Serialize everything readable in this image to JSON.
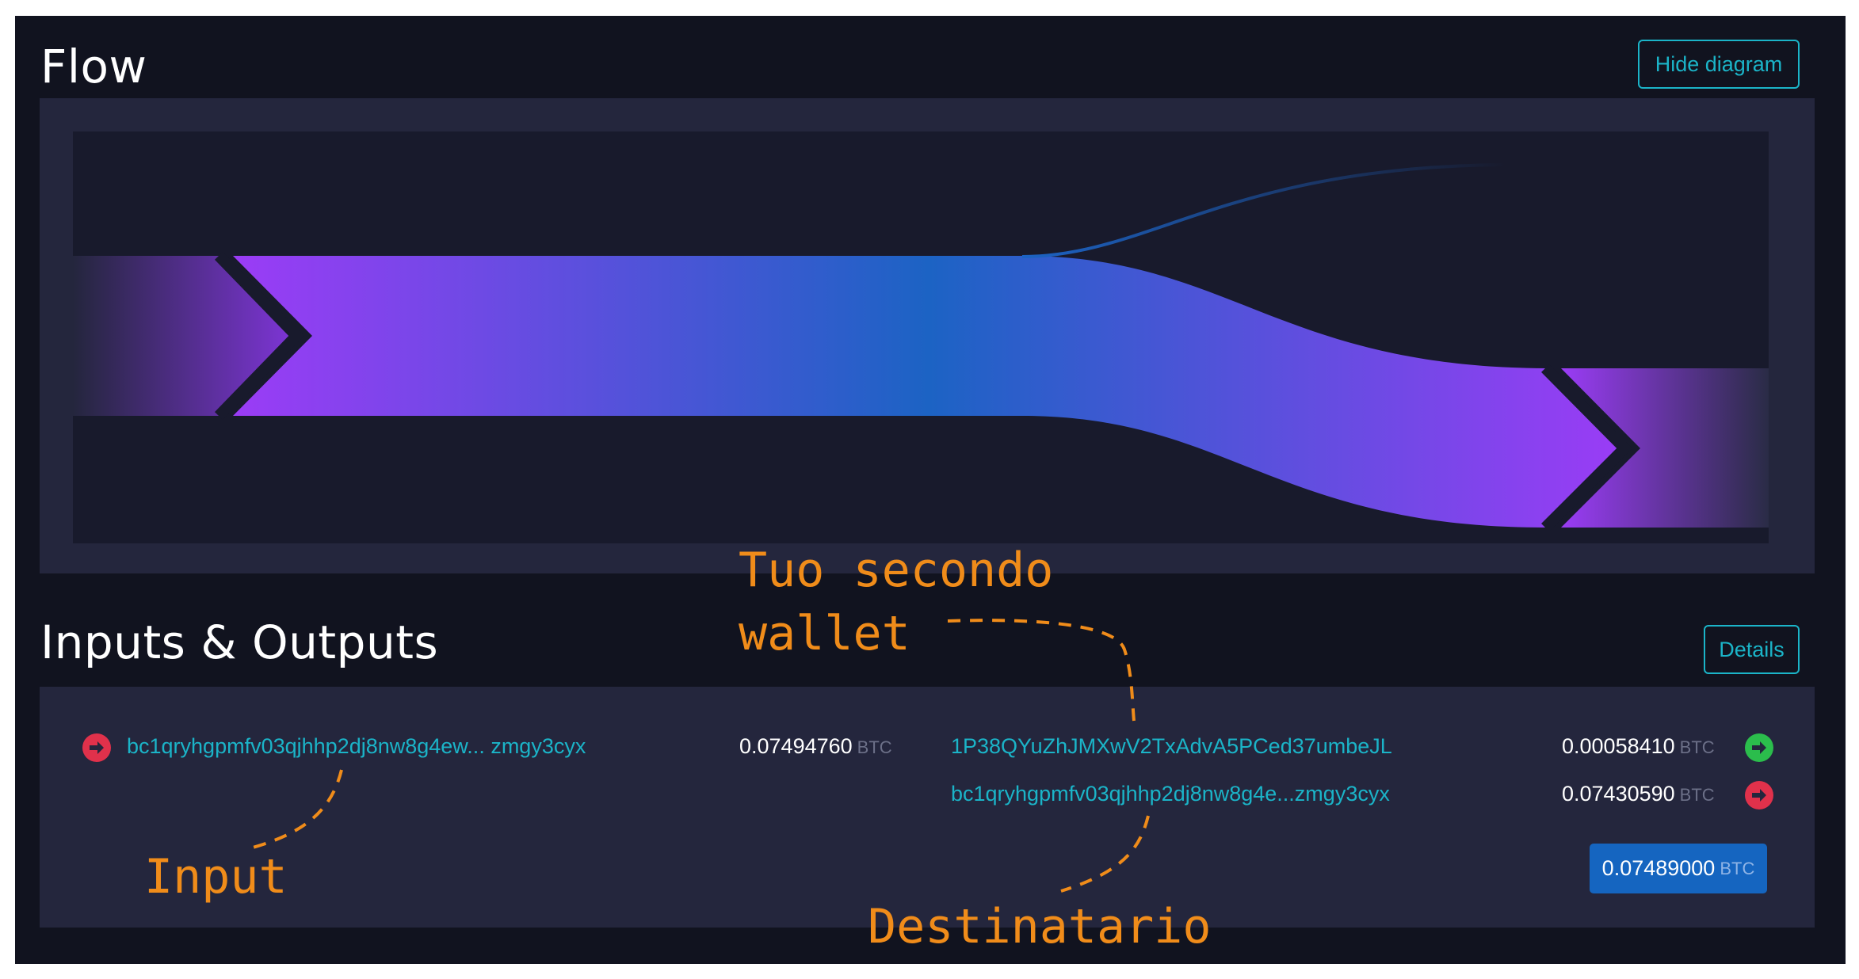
{
  "flow": {
    "title": "Flow",
    "hide_button": "Hide diagram"
  },
  "io": {
    "title": "Inputs & Outputs",
    "details_button": "Details",
    "inputs": [
      {
        "address": "bc1qryhgpmfv03qjhhp2dj8nw8g4ew... zmgy3cyx",
        "amount": "0.07494760",
        "unit": "BTC",
        "icon": "arrow-right-red-icon"
      }
    ],
    "outputs": [
      {
        "address": "1P38QYuZhJMXwV2TxAdvA5PCed37umbeJL",
        "amount": "0.00058410",
        "unit": "BTC",
        "icon": "arrow-right-green-icon"
      },
      {
        "address": "bc1qryhgpmfv03qjhhp2dj8nw8g4e...zmgy3cyx",
        "amount": "0.07430590",
        "unit": "BTC",
        "icon": "arrow-right-red-icon"
      }
    ],
    "total": {
      "amount": "0.07489000",
      "unit": "BTC"
    }
  },
  "annotations": {
    "second_wallet_line1": "Tuo secondo",
    "second_wallet_line2": "wallet",
    "input": "Input",
    "recipient": "Destinatario"
  },
  "colors": {
    "background": "#11131f",
    "panel": "#24263d",
    "accent": "#1bb4c8",
    "flow_purple": "#9b3cf6",
    "flow_blue": "#1c63c4",
    "output_red": "#e0314b",
    "output_green": "#2bbd4c",
    "annotation": "#f08c1a"
  }
}
